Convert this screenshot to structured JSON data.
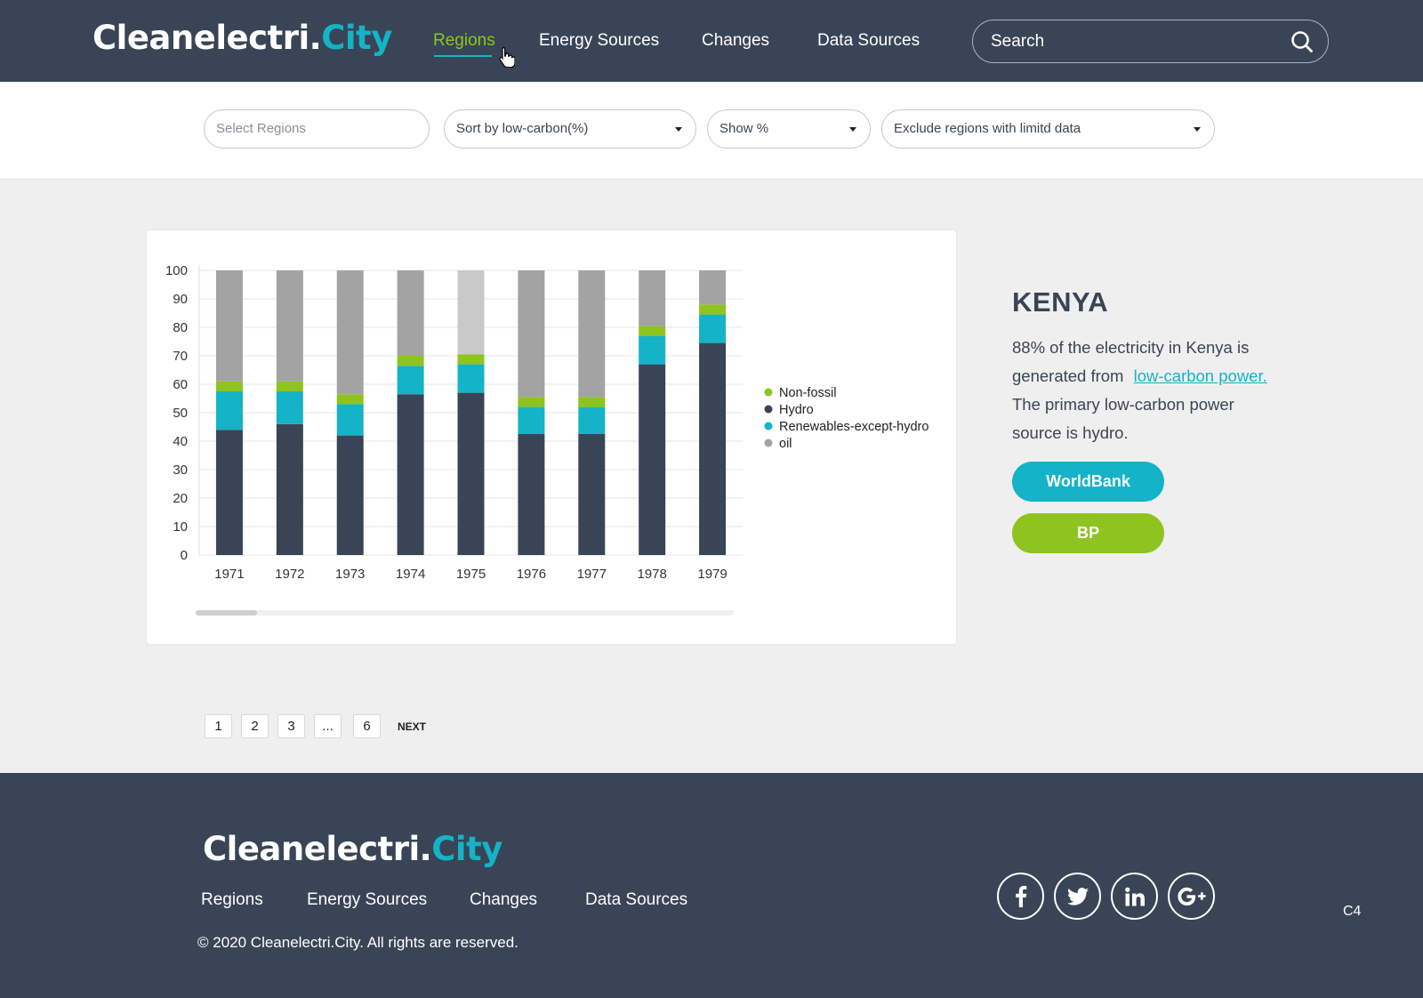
{
  "header": {
    "logo_main": "Cleanelectri.",
    "logo_accent": "City",
    "nav": [
      "Regions",
      "Energy Sources",
      "Changes",
      "Data Sources"
    ],
    "search_placeholder": "Search"
  },
  "filters": {
    "regions_placeholder": "Select Regions",
    "sort": "Sort by low-carbon(%)",
    "show": "Show %",
    "exclude": "Exclude regions with limitd data"
  },
  "chart_data": {
    "type": "bar",
    "stacked": true,
    "categories": [
      "1971",
      "1972",
      "1973",
      "1974",
      "1975",
      "1976",
      "1977",
      "1978",
      "1979"
    ],
    "series": [
      {
        "name": "Hydro",
        "color": "#394556",
        "values": [
          44,
          46,
          42,
          56.5,
          57,
          42.5,
          42.5,
          67,
          74.5
        ]
      },
      {
        "name": "Renewables-except-hydro",
        "color": "#14b3c7",
        "values": [
          13.5,
          11.5,
          11,
          10,
          10,
          9.5,
          9.5,
          10,
          10
        ]
      },
      {
        "name": "Non-fossil",
        "color": "#8fc31f",
        "values": [
          3.5,
          3.5,
          3.5,
          3.5,
          3.5,
          3.5,
          3.5,
          3.5,
          3.5
        ]
      },
      {
        "name": "oil",
        "color": "#a3a3a3",
        "values": [
          39,
          39,
          43.5,
          30,
          29.5,
          44.5,
          44.5,
          19.5,
          12
        ]
      }
    ],
    "highlight_category": "1975",
    "highlight_color": "#c9c9c9",
    "ylim": [
      0,
      100
    ],
    "yticks": [
      0,
      10,
      20,
      30,
      40,
      50,
      60,
      70,
      80,
      90,
      100
    ],
    "legend": [
      "Non-fossil",
      "Hydro",
      "Renewables-except-hydro",
      "oil"
    ],
    "legend_colors": [
      "#8fc31f",
      "#394556",
      "#14b3c7",
      "#a3a3a3"
    ],
    "legend_position": "right",
    "grid": true
  },
  "region": {
    "title": "KENYA",
    "desc_text": "88% of the electricity in Kenya is generated from ",
    "desc_link": "low-carbon power.",
    "desc_tail": " The primary low-carbon power source is hydro.",
    "btn_worldbank": "WorldBank",
    "btn_bp": "BP"
  },
  "pagination": {
    "pages": [
      "1",
      "2",
      "3",
      "...",
      "6"
    ],
    "next": "NEXT"
  },
  "footer": {
    "logo_main": "Cleanelectri.",
    "logo_accent": "City",
    "nav": [
      "Regions",
      "Energy Sources",
      "Changes",
      "Data Sources"
    ],
    "copyright": "© 2020 Cleanelectri.City. All rights are reserved.",
    "social": [
      "facebook-icon",
      "twitter-icon",
      "linkedin-icon",
      "google-plus-icon"
    ],
    "code": "C4"
  },
  "colors": {
    "navy": "#394556",
    "teal": "#14b3c7",
    "green": "#8fc31f"
  }
}
